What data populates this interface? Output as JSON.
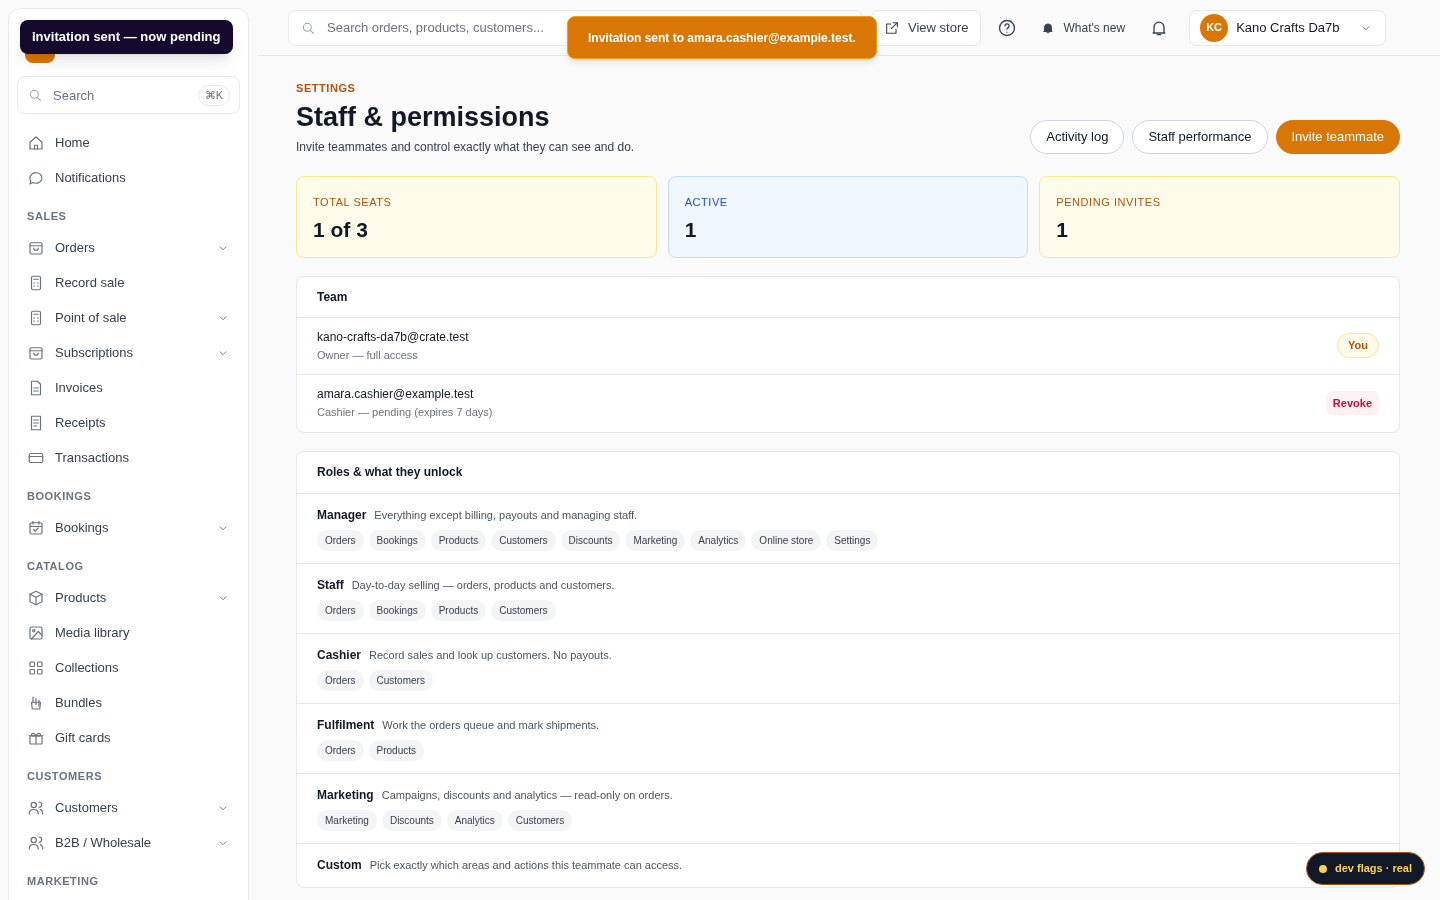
{
  "sidebar": {
    "tooltip": "Invitation sent — now pending",
    "search": {
      "placeholder": "Search",
      "shortcut": "⌘K"
    },
    "sections": [
      {
        "items": [
          {
            "label": "Home",
            "expandable": false
          },
          {
            "label": "Notifications",
            "expandable": false
          }
        ]
      },
      {
        "title": "SALES",
        "items": [
          {
            "label": "Orders",
            "expandable": true
          },
          {
            "label": "Record sale",
            "expandable": false
          },
          {
            "label": "Point of sale",
            "expandable": true
          },
          {
            "label": "Subscriptions",
            "expandable": true
          },
          {
            "label": "Invoices",
            "expandable": false
          },
          {
            "label": "Receipts",
            "expandable": false
          },
          {
            "label": "Transactions",
            "expandable": false
          }
        ]
      },
      {
        "title": "BOOKINGS",
        "items": [
          {
            "label": "Bookings",
            "expandable": true
          }
        ]
      },
      {
        "title": "CATALOG",
        "items": [
          {
            "label": "Products",
            "expandable": true
          },
          {
            "label": "Media library",
            "expandable": false
          },
          {
            "label": "Collections",
            "expandable": false
          },
          {
            "label": "Bundles",
            "expandable": false
          },
          {
            "label": "Gift cards",
            "expandable": false
          }
        ]
      },
      {
        "title": "CUSTOMERS",
        "items": [
          {
            "label": "Customers",
            "expandable": true
          },
          {
            "label": "B2B / Wholesale",
            "expandable": true
          }
        ]
      },
      {
        "title": "MARKETING"
      }
    ]
  },
  "topbar": {
    "search": {
      "placeholder": "Search orders, products, customers..."
    },
    "toast": "Invitation sent to amara.cashier@example.test.",
    "view_store": "View store",
    "whats_new": "What's new",
    "account": {
      "initials": "KC",
      "name": "Kano Crafts Da7b"
    }
  },
  "header": {
    "eyebrow": "SETTINGS",
    "title": "Staff & permissions",
    "subtitle": "Invite teammates and control exactly what they can see and do.",
    "buttons": [
      {
        "label": "Activity log",
        "kind": "secondary"
      },
      {
        "label": "Staff performance",
        "kind": "secondary"
      },
      {
        "label": "Invite teammate",
        "kind": "primary"
      }
    ]
  },
  "stats": [
    {
      "label": "TOTAL SEATS",
      "value": "1 of 3",
      "kind": "amber"
    },
    {
      "label": "ACTIVE",
      "value": "1",
      "kind": "blue"
    },
    {
      "label": "PENDING INVITES",
      "value": "1",
      "kind": "amber"
    }
  ],
  "team": {
    "title": "Team",
    "members": [
      {
        "email": "kano-crafts-da7b@crate.test",
        "detail": "Owner — full access",
        "action": {
          "label": "You",
          "kind": "badge"
        }
      },
      {
        "email": "amara.cashier@example.test",
        "detail": "Cashier — pending (expires 7 days)",
        "action": {
          "label": "Revoke",
          "kind": "danger"
        }
      }
    ]
  },
  "roles": {
    "title": "Roles & what they unlock",
    "items": [
      {
        "name": "Manager",
        "description": "Everything except billing, payouts and managing staff.",
        "areas": [
          "Orders",
          "Bookings",
          "Products",
          "Customers",
          "Discounts",
          "Marketing",
          "Analytics",
          "Online store",
          "Settings"
        ]
      },
      {
        "name": "Staff",
        "description": "Day-to-day selling — orders, products and customers.",
        "areas": [
          "Orders",
          "Bookings",
          "Products",
          "Customers"
        ]
      },
      {
        "name": "Cashier",
        "description": "Record sales and look up customers. No payouts.",
        "areas": [
          "Orders",
          "Customers"
        ]
      },
      {
        "name": "Fulfilment",
        "description": "Work the orders queue and mark shipments.",
        "areas": [
          "Orders",
          "Products"
        ]
      },
      {
        "name": "Marketing",
        "description": "Campaigns, discounts and analytics — read-only on orders.",
        "areas": [
          "Marketing",
          "Discounts",
          "Analytics",
          "Customers"
        ]
      },
      {
        "name": "Custom",
        "description": "Pick exactly which areas and actions this teammate can access."
      }
    ]
  },
  "dev_flags": "dev flags · real"
}
